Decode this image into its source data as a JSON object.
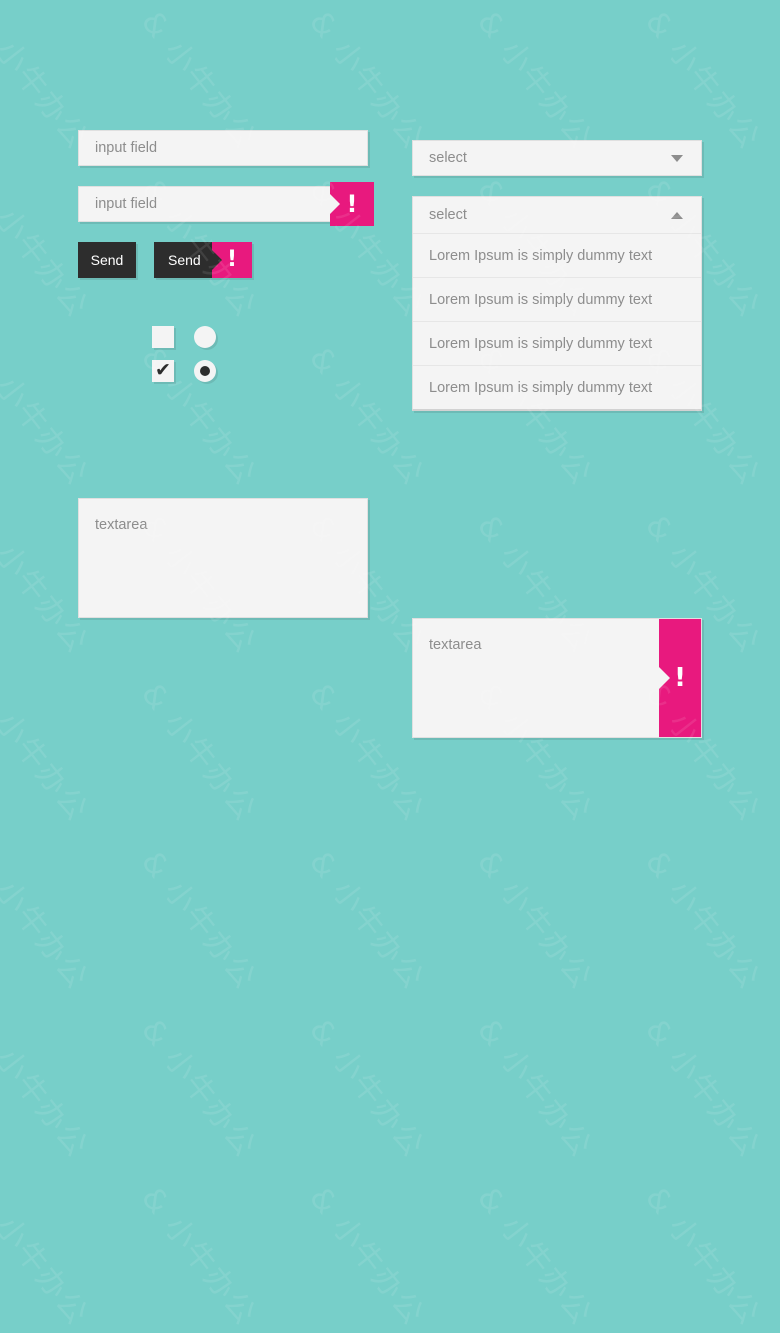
{
  "theme": {
    "background": "#77cfc9",
    "field_bg": "#f4f4f4",
    "field_border": "#e0e0e0",
    "placeholder_color": "#8d8d8d",
    "accent_dark": "#2d2d2d",
    "error_pink": "#e8197e",
    "error_text_color": "#ffffff"
  },
  "watermark": {
    "text": "& 小牛办公"
  },
  "inputs": [
    {
      "placeholder": "input field",
      "has_error": false
    },
    {
      "placeholder": "input field",
      "has_error": true,
      "error_glyph": "!"
    }
  ],
  "buttons": [
    {
      "label": "Send",
      "has_error": false
    },
    {
      "label": "Send",
      "has_error": true,
      "error_glyph": "!"
    }
  ],
  "checkboxes": [
    {
      "checked": false,
      "glyph": ""
    },
    {
      "checked": true,
      "glyph": "✔"
    }
  ],
  "radios": [
    {
      "checked": false
    },
    {
      "checked": true
    }
  ],
  "select_closed": {
    "value": "select",
    "caret_icon": "chevron-down-icon"
  },
  "select_open": {
    "value": "select",
    "caret_icon": "chevron-up-icon",
    "options": [
      "Lorem Ipsum is simply dummy text",
      "Lorem Ipsum is simply dummy text",
      "Lorem Ipsum is simply dummy text",
      "Lorem Ipsum is simply dummy text"
    ]
  },
  "textareas": [
    {
      "placeholder": "textarea",
      "has_error": false
    },
    {
      "placeholder": "textarea",
      "has_error": true,
      "error_glyph": "!"
    }
  ]
}
